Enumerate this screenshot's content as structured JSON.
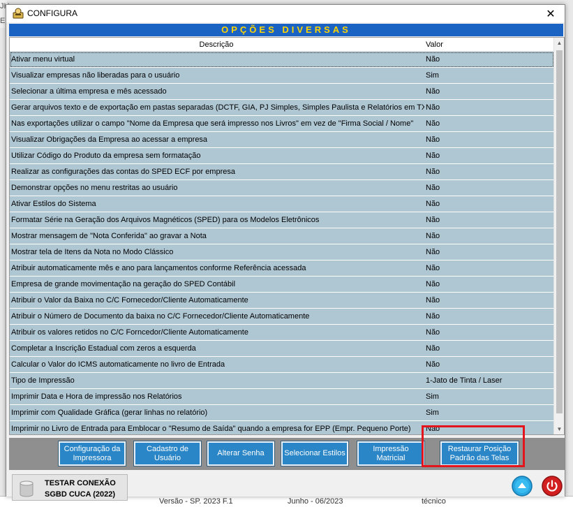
{
  "background": {
    "left_fragment_1": "JH",
    "left_fragment_2": "E",
    "bottom_cells": [
      "Versão - SP. 2023 F.1",
      "Junho - 06/2023",
      "técnico"
    ]
  },
  "window": {
    "title": "CONFIGURA",
    "close_symbol": "✕",
    "icon": "app-icon"
  },
  "banner": "OPÇÕES DIVERSAS",
  "grid": {
    "columns": {
      "description": "Descrição",
      "value": "Valor"
    },
    "rows": [
      {
        "description": "Ativar menu virtual",
        "value": "Não"
      },
      {
        "description": "Visualizar empresas não liberadas para o usuário",
        "value": "Sim"
      },
      {
        "description": "Selecionar a última empresa e mês acessado",
        "value": "Não"
      },
      {
        "description": "Gerar arquivos texto e de exportação em pastas separadas (DCTF, GIA, PJ Simples, Simples Paulista e Relatórios em TXT)",
        "value": "Não"
      },
      {
        "description": "Nas exportações utilizar o campo \"Nome da Empresa que será impresso nos Livros\" em vez de \"Firma Social / Nome\"",
        "value": "Não"
      },
      {
        "description": "Visualizar Obrigações da Empresa ao acessar a empresa",
        "value": "Não"
      },
      {
        "description": "Utilizar Código do Produto da empresa sem formatação",
        "value": "Não"
      },
      {
        "description": "Realizar as configurações das contas do SPED ECF por empresa",
        "value": "Não"
      },
      {
        "description": "Demonstrar opções no menu restritas ao usuário",
        "value": "Não"
      },
      {
        "description": "Ativar Estilos do Sistema",
        "value": "Não"
      },
      {
        "description": "Formatar Série na Geração dos Arquivos Magnéticos (SPED) para os Modelos Eletrônicos",
        "value": "Não"
      },
      {
        "description": "Mostrar mensagem de \"Nota Conferida\" ao gravar a Nota",
        "value": "Não"
      },
      {
        "description": "Mostrar tela de Itens da Nota no Modo Clássico",
        "value": "Não"
      },
      {
        "description": "Atribuir automaticamente mês e ano para lançamentos conforme Referência acessada",
        "value": "Não"
      },
      {
        "description": "Empresa de grande movimentação na geração do SPED Contábil",
        "value": "Não"
      },
      {
        "description": "Atribuir o Valor da Baixa no C/C Fornecedor/Cliente Automaticamente",
        "value": "Não"
      },
      {
        "description": "Atribuir o Número de Documento da baixa no C/C Fornecedor/Cliente Automaticamente",
        "value": "Não"
      },
      {
        "description": "Atribuir os valores retidos no C/C Forncedor/Cliente Automaticamente",
        "value": "Não"
      },
      {
        "description": "Completar a Inscrição Estadual com zeros a esquerda",
        "value": "Não"
      },
      {
        "description": "Calcular o Valor do ICMS automaticamente no livro de Entrada",
        "value": "Não"
      },
      {
        "description": "Tipo de Impressão",
        "value": "1-Jato de Tinta / Laser"
      },
      {
        "description": "Imprimir Data e Hora de impressão nos Relatórios",
        "value": "Sim"
      },
      {
        "description": "Imprimir com Qualidade Gráfica (gerar linhas no relatório)",
        "value": "Sim"
      },
      {
        "description": "Imprimir no Livro de Entrada para Emblocar o \"Resumo de Saída\" quando a empresa for EPP (Empr. Pequeno Porte)",
        "value": "Não"
      }
    ]
  },
  "toolbar": {
    "config_printer": [
      "Configuração da",
      "Impressora"
    ],
    "user_register": [
      "Cadastro de",
      "Usuário"
    ],
    "change_password": "Alterar Senha",
    "select_styles": "Selecionar Estilos",
    "matrix_print": "Impressão Matricial",
    "restore_position": [
      "Restaurar Posição",
      "Padrão das Telas"
    ]
  },
  "footer": {
    "test_connection": "TESTAR CONEXÃO",
    "db_name": "SGBD CUCA (2022)",
    "up_icon": "arrow-up-icon",
    "power_icon": "power-icon"
  },
  "colors": {
    "banner_bg": "#1a63c2",
    "banner_text": "#ffd400",
    "row_bg": "#afc6d3",
    "button_bg": "#2a86c7",
    "highlight": "#e3141c"
  }
}
